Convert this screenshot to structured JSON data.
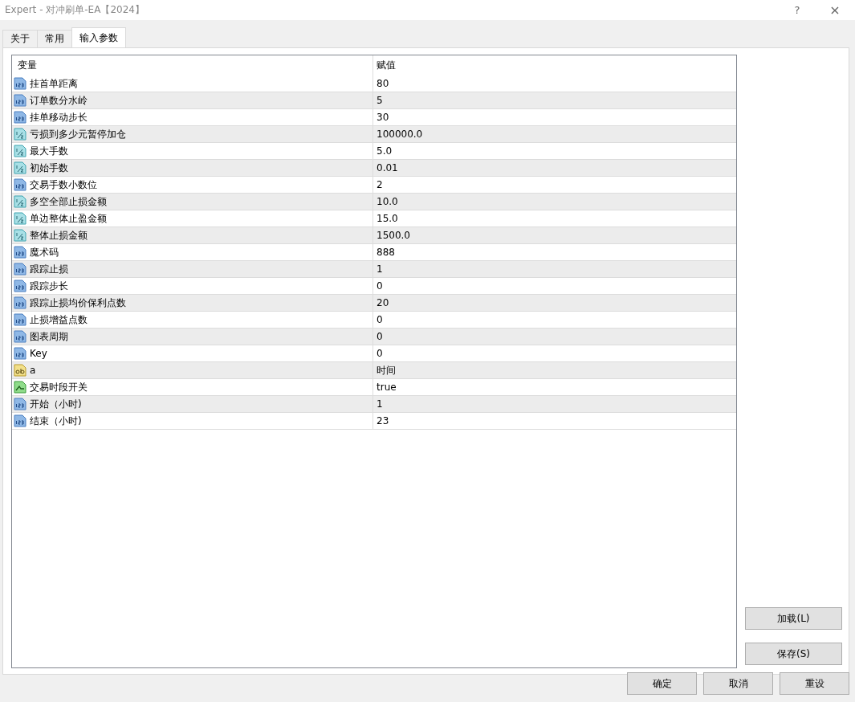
{
  "window": {
    "title": "Expert - 对冲刷单-EA【2024】",
    "help": "?",
    "close": "×"
  },
  "tabs": [
    {
      "label": "关于",
      "selected": false
    },
    {
      "label": "常用",
      "selected": false
    },
    {
      "label": "输入参数",
      "selected": true
    }
  ],
  "table": {
    "columns": [
      "变量",
      "赋值"
    ],
    "rows": [
      {
        "kind": "int",
        "name": "挂首单距离",
        "value": "80"
      },
      {
        "kind": "int",
        "name": "订单数分水岭",
        "value": "5"
      },
      {
        "kind": "int",
        "name": "挂单移动步长",
        "value": "30"
      },
      {
        "kind": "double",
        "name": "亏损到多少元暂停加仓",
        "value": "100000.0"
      },
      {
        "kind": "double",
        "name": "最大手数",
        "value": "5.0"
      },
      {
        "kind": "double",
        "name": "初始手数",
        "value": "0.01"
      },
      {
        "kind": "int",
        "name": "交易手数小数位",
        "value": "2"
      },
      {
        "kind": "double",
        "name": "多空全部止损金额",
        "value": "10.0"
      },
      {
        "kind": "double",
        "name": "单边整体止盈金额",
        "value": "15.0"
      },
      {
        "kind": "double",
        "name": "整体止损金额",
        "value": "1500.0"
      },
      {
        "kind": "int",
        "name": "魔术码",
        "value": "888"
      },
      {
        "kind": "int",
        "name": "跟踪止损",
        "value": "1"
      },
      {
        "kind": "int",
        "name": "跟踪步长",
        "value": "0"
      },
      {
        "kind": "int",
        "name": "跟踪止损均价保利点数",
        "value": "20"
      },
      {
        "kind": "int",
        "name": "止损增益点数",
        "value": "0"
      },
      {
        "kind": "int",
        "name": "图表周期",
        "value": "0"
      },
      {
        "kind": "int",
        "name": "Key",
        "value": "0"
      },
      {
        "kind": "string",
        "name": "a",
        "value": "时间"
      },
      {
        "kind": "bool",
        "name": "交易时段开关",
        "value": "true"
      },
      {
        "kind": "int",
        "name": "开始（小时)",
        "value": "1"
      },
      {
        "kind": "int",
        "name": "结束（小时)",
        "value": "23"
      }
    ]
  },
  "side_buttons": [
    "加载(L)",
    "保存(S)"
  ],
  "buttons": [
    "确定",
    "取消",
    "重设"
  ]
}
